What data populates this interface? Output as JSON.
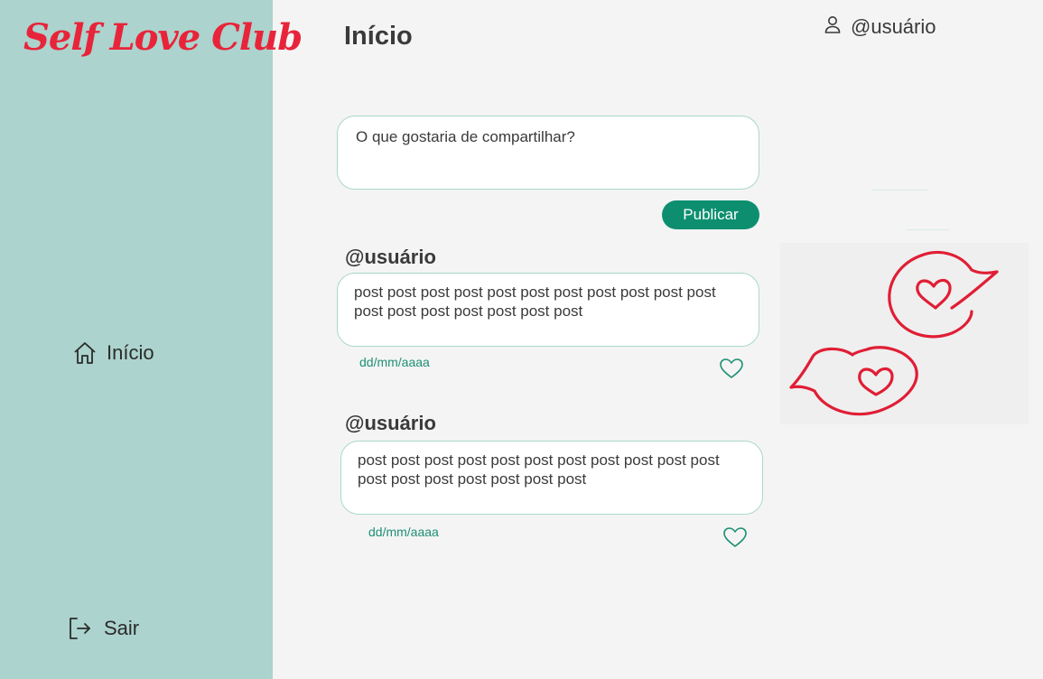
{
  "app": {
    "logo_text": "Self Love Club"
  },
  "sidebar": {
    "items": [
      {
        "label": "Início",
        "icon": "home-icon"
      },
      {
        "label": "Sair",
        "icon": "logout-icon"
      }
    ]
  },
  "header": {
    "title": "Início",
    "user": "@usuário",
    "user_icon": "user-icon"
  },
  "composer": {
    "placeholder": "O que gostaria de compartilhar?",
    "publish_label": "Publicar"
  },
  "posts": [
    {
      "user": "@usuário",
      "text": "post post post post post post post post post post post post post post post post post post",
      "date": "dd/mm/aaaa"
    },
    {
      "user": "@usuário",
      "text": "post post post post post post post post post post post post post post post post post post",
      "date": "dd/mm/aaaa"
    }
  ],
  "colors": {
    "sidebar": "#acd3cd",
    "accent": "#0d8f6f",
    "brand": "#e8243a",
    "border": "#a9d7cd",
    "background": "#f4f4f4"
  }
}
